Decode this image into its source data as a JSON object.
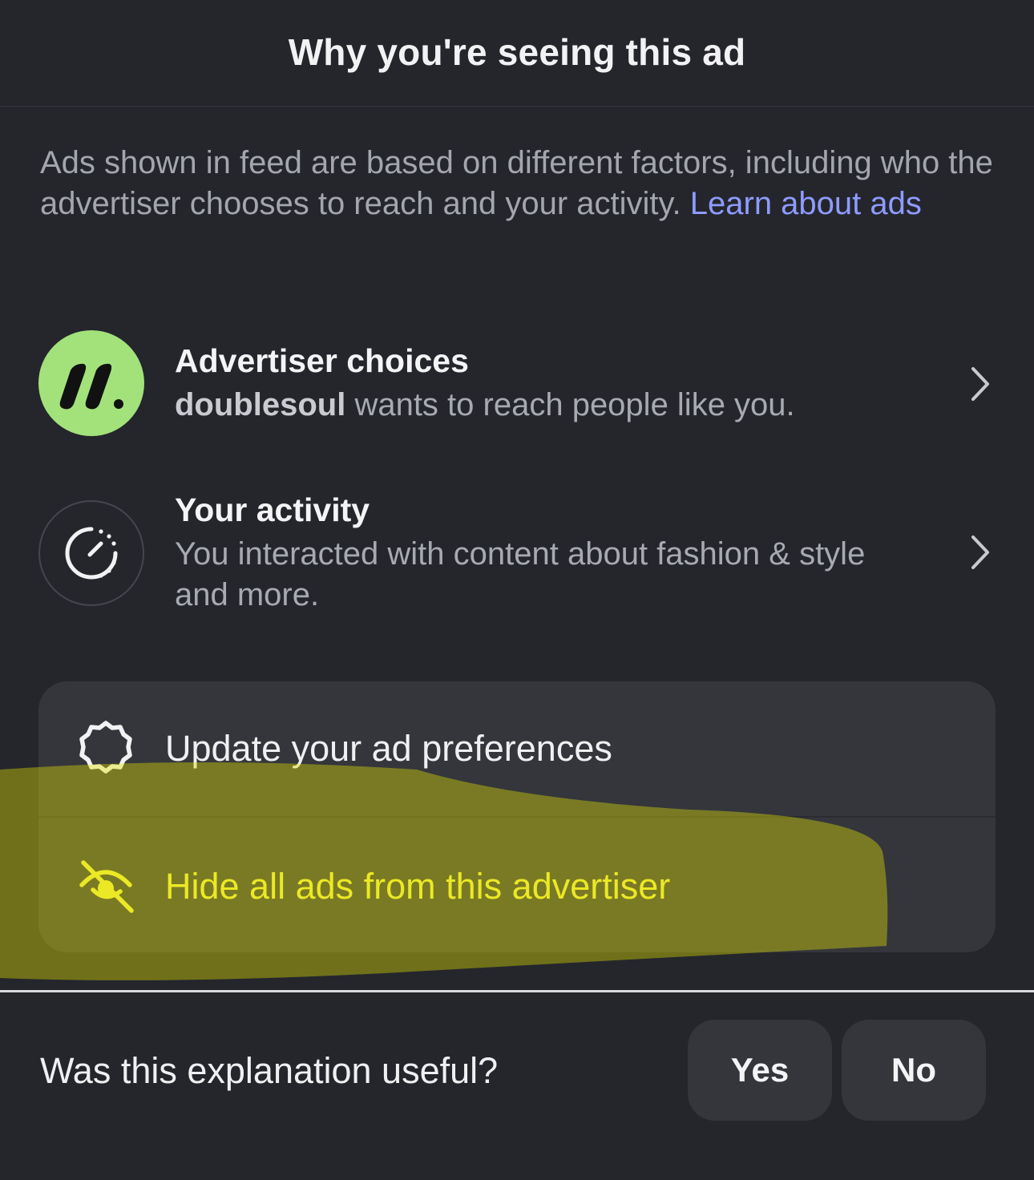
{
  "header": {
    "title": "Why you're seeing this ad"
  },
  "intro": {
    "text": "Ads shown in feed are based on different factors, including who the advertiser chooses to reach and your activity. ",
    "link": "Learn about ads"
  },
  "rows": [
    {
      "title": "Advertiser choices",
      "advertiser": "doublesoul",
      "desc": " wants to reach people like you.",
      "icon": "advertiser-logo-icon"
    },
    {
      "title": "Your activity",
      "desc": "You interacted with content about fashion & style and more.",
      "icon": "activity-timer-icon"
    }
  ],
  "menu": [
    {
      "label": "Update your ad preferences",
      "icon": "gear-icon"
    },
    {
      "label": "Hide all ads from this advertiser",
      "icon": "eye-slash-icon"
    }
  ],
  "feedback": {
    "question": "Was this explanation useful?",
    "yes": "Yes",
    "no": "No"
  },
  "colors": {
    "background": "#24262c",
    "link": "#8f9bff",
    "logo_green": "#a3e27b",
    "highlight": "#e3e200"
  }
}
